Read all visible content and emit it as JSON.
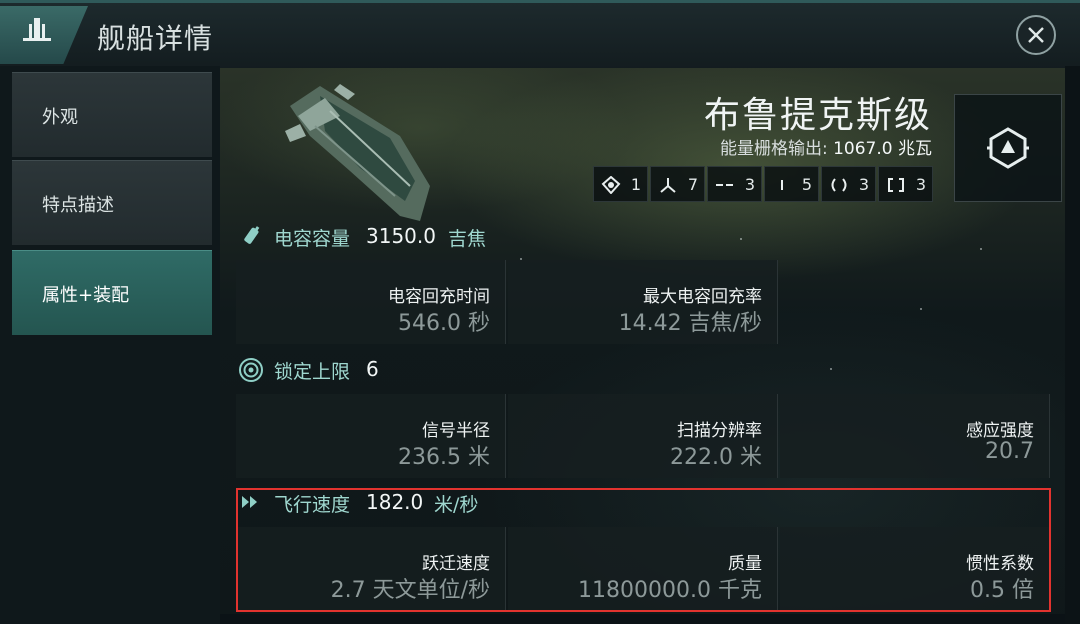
{
  "header": {
    "title": "舰船详情"
  },
  "sidebar": {
    "items": [
      {
        "label": "外观",
        "active": false
      },
      {
        "label": "特点描述",
        "active": false
      },
      {
        "label": "属性+装配",
        "active": true
      }
    ]
  },
  "ship": {
    "name": "布鲁提克斯级",
    "power_label": "能量栅格输出:",
    "power_value": "1067.0",
    "power_unit": "兆瓦"
  },
  "slots": [
    {
      "icon": "turret-slot-icon",
      "count": "1"
    },
    {
      "icon": "drone-slot-icon",
      "count": "7"
    },
    {
      "icon": "high-slot-icon",
      "count": "3"
    },
    {
      "icon": "mid-slot-icon",
      "count": "5"
    },
    {
      "icon": "low-slot-icon",
      "count": "3"
    },
    {
      "icon": "rig-slot-icon",
      "count": "3"
    }
  ],
  "capacitor": {
    "label": "电容容量",
    "value": "3150.0",
    "unit": "吉焦",
    "stats": [
      {
        "label": "电容回充时间",
        "value": "546.0 秒"
      },
      {
        "label": "最大电容回充率",
        "value": "14.42 吉焦/秒"
      }
    ]
  },
  "targeting": {
    "label": "锁定上限",
    "value": "6",
    "stats": [
      {
        "label": "信号半径",
        "value": "236.5 米"
      },
      {
        "label": "扫描分辨率",
        "value": "222.0 米"
      },
      {
        "label": "感应强度",
        "value": "20.7"
      }
    ]
  },
  "navigation": {
    "label": "飞行速度",
    "value": "182.0",
    "unit": "米/秒",
    "stats": [
      {
        "label": "跃迁速度",
        "value": "2.7 天文单位/秒"
      },
      {
        "label": "质量",
        "value": "11800000.0 千克"
      },
      {
        "label": "惯性系数",
        "value": "0.5 倍"
      }
    ]
  },
  "colors": {
    "accent": "#9fd7cf",
    "active_tab": "#2f6b66",
    "highlight": "#e2332f"
  }
}
